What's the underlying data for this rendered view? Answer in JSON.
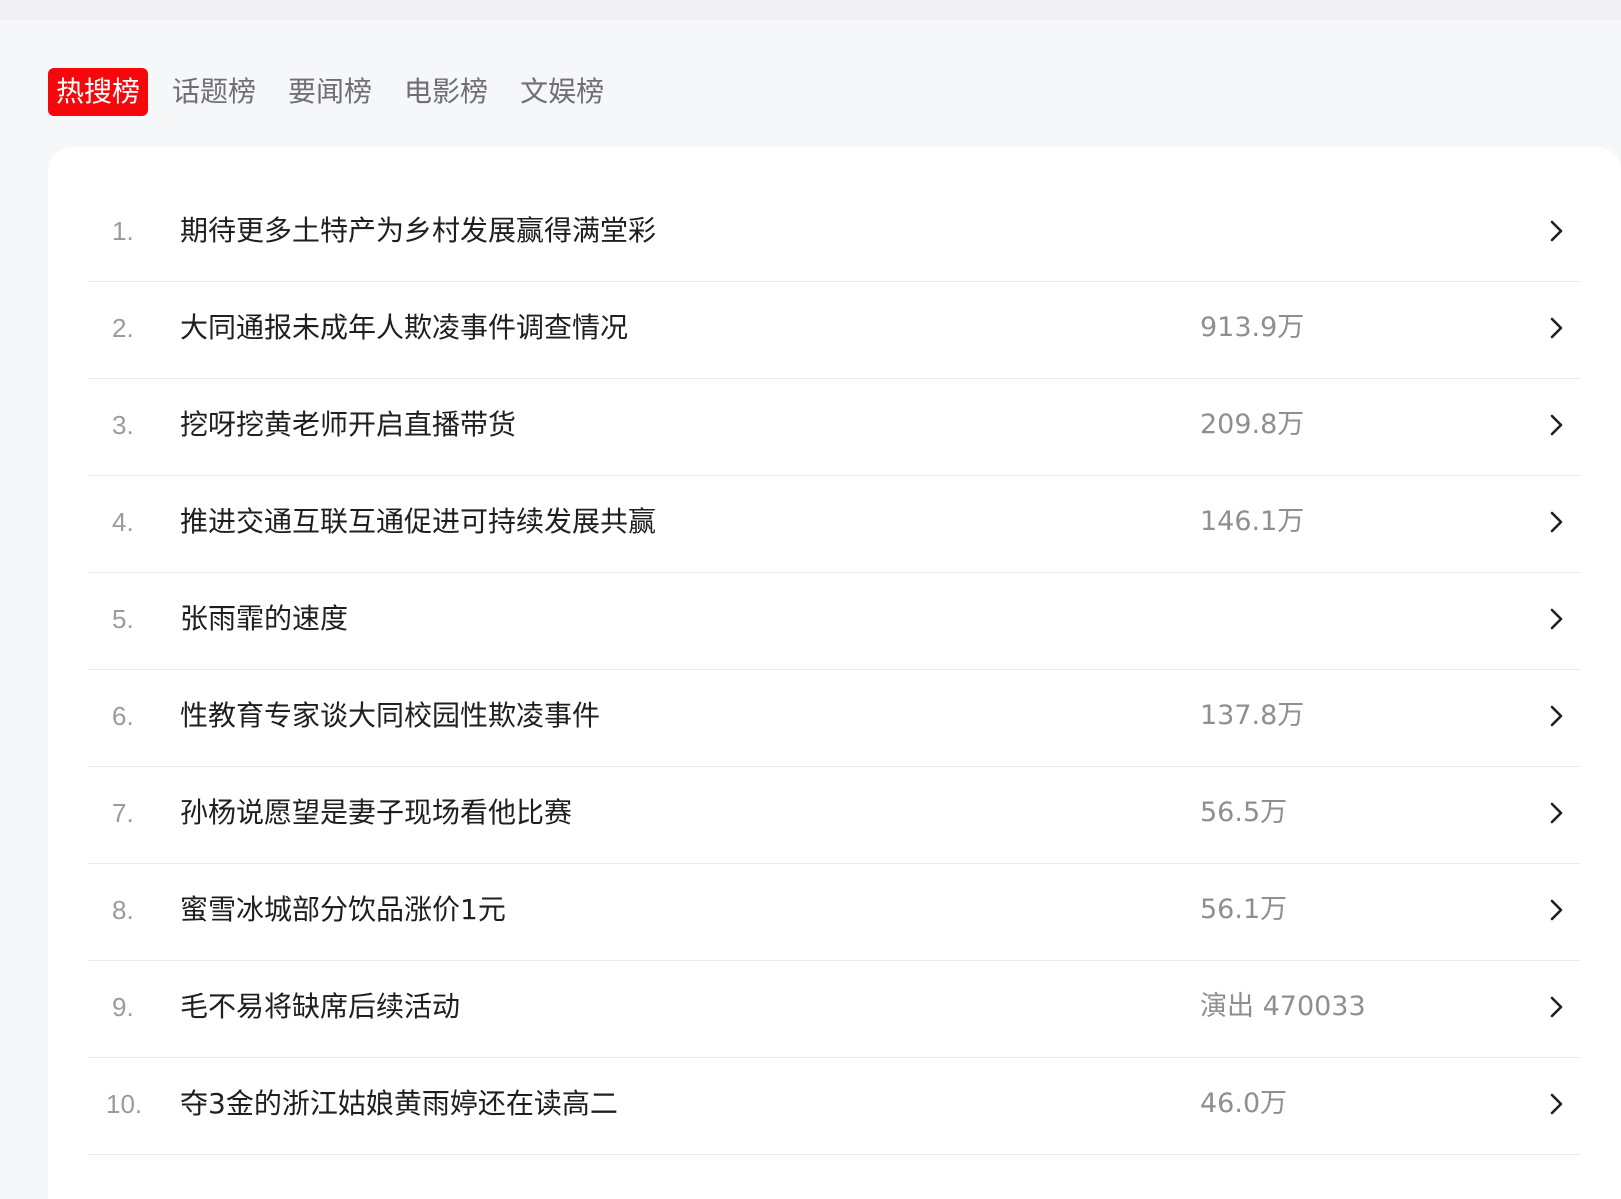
{
  "tabs": [
    {
      "label": "热搜榜",
      "active": true
    },
    {
      "label": "话题榜",
      "active": false
    },
    {
      "label": "要闻榜",
      "active": false
    },
    {
      "label": "电影榜",
      "active": false
    },
    {
      "label": "文娱榜",
      "active": false
    }
  ],
  "list": [
    {
      "rank": "1.",
      "title": "期待更多土特产为乡村发展赢得满堂彩",
      "heat": ""
    },
    {
      "rank": "2.",
      "title": "大同通报未成年人欺凌事件调查情况",
      "heat": "913.9万"
    },
    {
      "rank": "3.",
      "title": "挖呀挖黄老师开启直播带货",
      "heat": "209.8万"
    },
    {
      "rank": "4.",
      "title": "推进交通互联互通促进可持续发展共赢",
      "heat": "146.1万"
    },
    {
      "rank": "5.",
      "title": "张雨霏的速度",
      "heat": ""
    },
    {
      "rank": "6.",
      "title": "性教育专家谈大同校园性欺凌事件",
      "heat": "137.8万"
    },
    {
      "rank": "7.",
      "title": "孙杨说愿望是妻子现场看他比赛",
      "heat": "56.5万"
    },
    {
      "rank": "8.",
      "title": "蜜雪冰城部分饮品涨价1元",
      "heat": "56.1万"
    },
    {
      "rank": "9.",
      "title": "毛不易将缺席后续活动",
      "heat": "演出 470033"
    },
    {
      "rank": "10.",
      "title": "夺3金的浙江姑娘黄雨婷还在读高二",
      "heat": "46.0万"
    }
  ],
  "icons": {
    "row_action": "chevron-right-icon"
  },
  "colors": {
    "accent": "#f5070b",
    "page_background": "#f6f7f9",
    "panel_background": "#ffffff",
    "tab_inactive": "#6f6f75",
    "title_text": "#1f1f1f",
    "heat_text": "#8e8e94"
  }
}
